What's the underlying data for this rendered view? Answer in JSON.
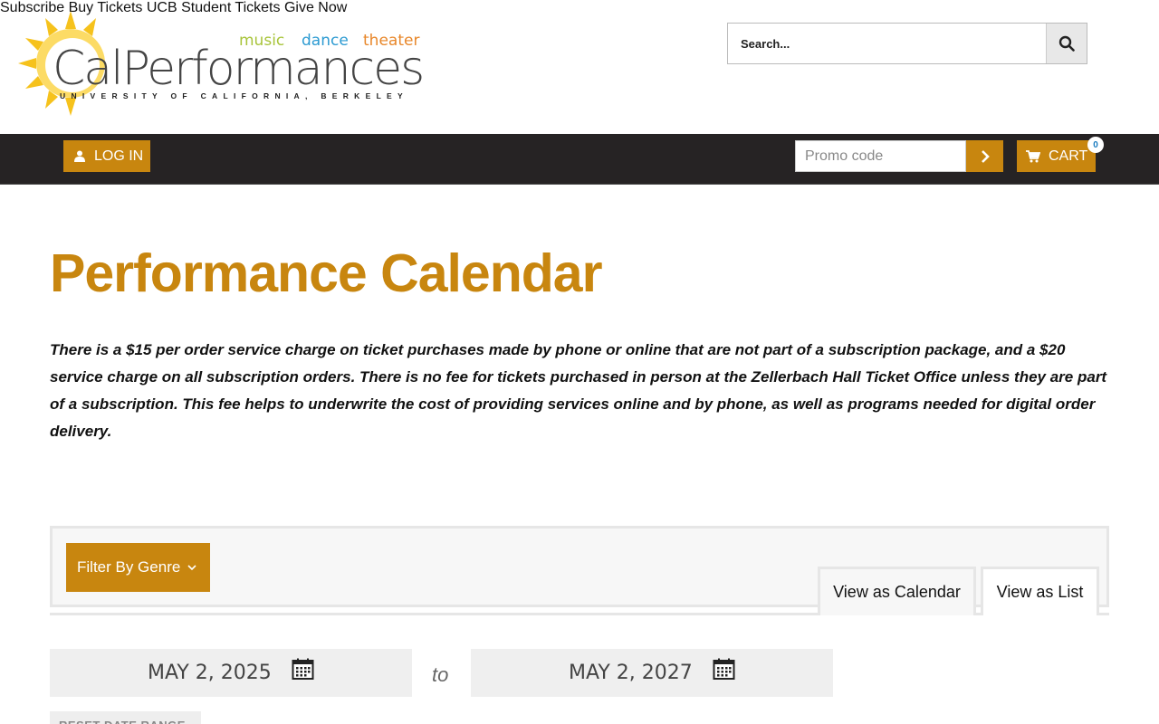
{
  "header": {
    "logo": {
      "tags": [
        "music",
        "dance",
        "theater"
      ],
      "wordmark": "CalPerformances",
      "subline": "UNIVERSITY OF CALIFORNIA, BERKELEY"
    },
    "search": {
      "placeholder": "Search...",
      "icon": "search-icon"
    },
    "nav": [
      "Subscribe",
      "Buy Tickets",
      "UCB Student Tickets",
      "Give Now"
    ]
  },
  "utilbar": {
    "login_label": "LOG IN",
    "login_icon": "user-icon",
    "promo_placeholder": "Promo code",
    "promo_submit_icon": "chevron-right-icon",
    "cart_label": "CART",
    "cart_icon": "cart-icon",
    "cart_count": "0"
  },
  "main": {
    "title": "Performance Calendar",
    "notice": "There is a $15 per order service charge on ticket purchases made by phone or online that are not part of a subscription package, and a $20 service charge on all subscription orders. There is no fee for tickets purchased in person at the Zellerbach Hall Ticket Office unless they are part of a subscription. This fee helps to underwrite the cost of providing services online and by phone, as well as programs needed for digital order delivery.",
    "filter_genre_label": "Filter By Genre",
    "view_calendar_label": "View as Calendar",
    "view_list_label": "View as List",
    "date_from": "MAY 2, 2025",
    "date_to": "MAY 2, 2027",
    "to_label": "to",
    "reset_label": "RESET DATE RANGE"
  },
  "colors": {
    "accent": "#c8860f",
    "nav_bg": "#595959",
    "utilbar_bg": "#262324",
    "tag_music": "#a8c43a",
    "tag_dance": "#2d9bd2",
    "tag_theater": "#e8872a"
  }
}
